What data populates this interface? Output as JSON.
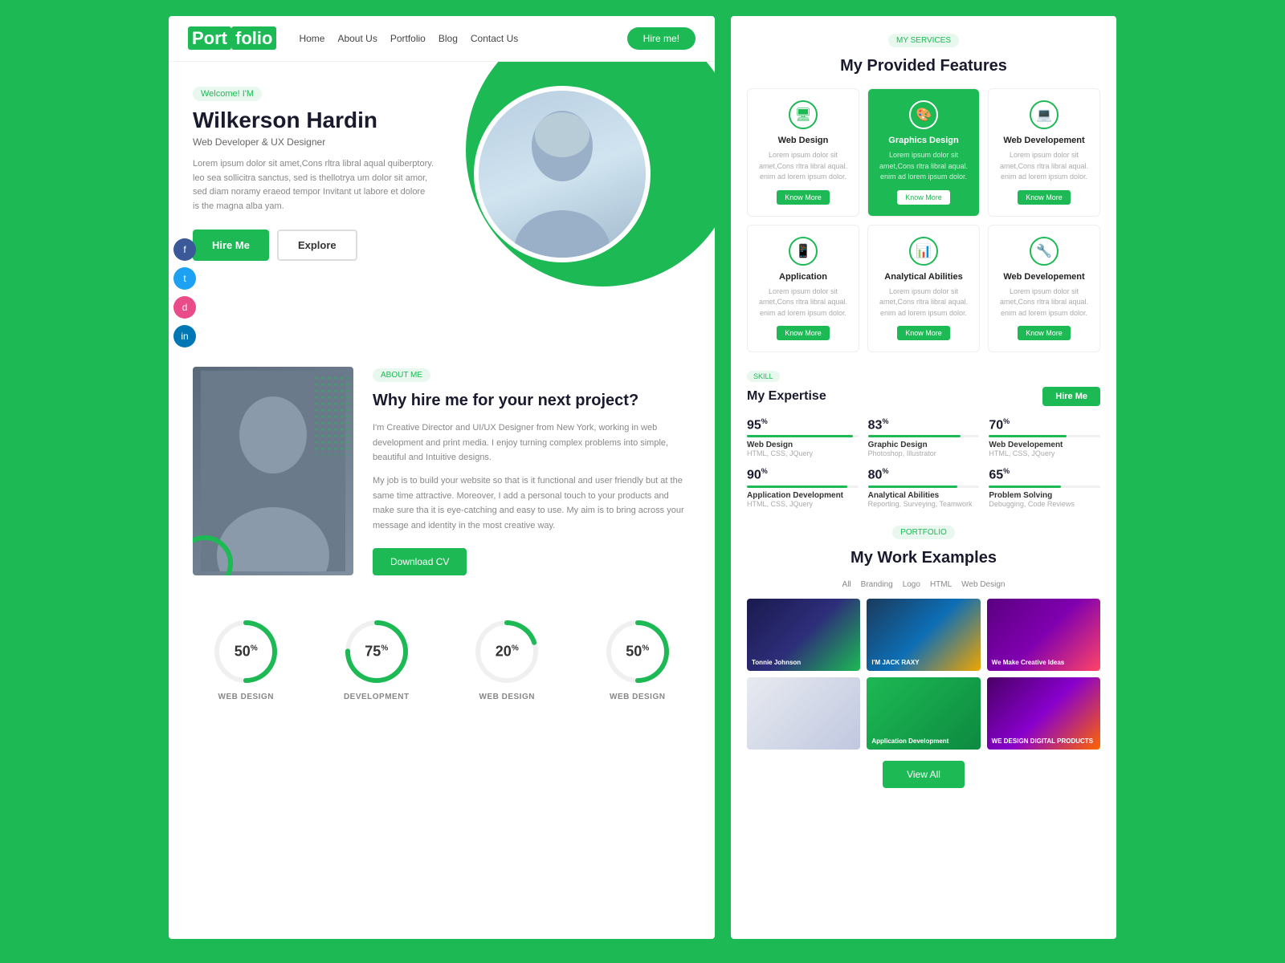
{
  "brand": {
    "name_start": "Port",
    "name_end": "folio"
  },
  "navbar": {
    "links": [
      "Home",
      "About Us",
      "Portfolio",
      "Blog",
      "Contact Us"
    ],
    "hire_btn": "Hire me!"
  },
  "hero": {
    "welcome": "Welcome! I'M",
    "name": "Wilkerson Hardin",
    "title": "Web Developer & UX Designer",
    "description": "Lorem ipsum dolor sit amet,Cons rltra libral aqual quiberptory. leo sea sollicitra sanctus, sed is thellotrya um dolor sit amor, sed diam noramy eraeod tempor Invitant ut labore et dolore is the magna alba yam.",
    "hire_btn": "Hire Me",
    "explore_btn": "Explore"
  },
  "social": {
    "icons": [
      "f",
      "t",
      "d",
      "in"
    ]
  },
  "about": {
    "badge": "ABOUT ME",
    "heading": "Why hire me for your next project?",
    "para1": "I'm Creative Director and UI/UX Designer from New York, working in web development and print media. I enjoy turning complex problems into simple, beautiful and Intuitive designs.",
    "para2": "My job is to build your website so that is it functional and user friendly but at the same time attractive. Moreover, I add a personal touch to your products and make sure tha it is eye-catching and easy to use. My aim is to bring across your message and identity in the most creative way.",
    "download_btn": "Download CV"
  },
  "stats": [
    {
      "pct": "50",
      "label": "WEB DESIGN"
    },
    {
      "pct": "75",
      "label": "DEVELOPMENT"
    },
    {
      "pct": "20",
      "label": "WEB DESIGN"
    },
    {
      "pct": "50",
      "label": "WEB DESIGN"
    }
  ],
  "services": {
    "badge": "MY SERVICES",
    "title": "My Provided Features",
    "items": [
      {
        "icon": "🖥",
        "title": "Web Design",
        "desc": "Lorem ipsum dolor sit amet,Cons rltra libral aqual. enim ad lorem ipsum dolor.",
        "featured": false
      },
      {
        "icon": "🎨",
        "title": "Graphics Design",
        "desc": "Lorem ipsum dolor sit amet,Cons rltra libral aqual. enim ad lorem ipsum dolor.",
        "featured": true
      },
      {
        "icon": "💻",
        "title": "Web Developement",
        "desc": "Lorem ipsum dolor sit amet,Cons rltra libral aqual. enim ad lorem ipsum dolor.",
        "featured": false
      },
      {
        "icon": "📱",
        "title": "Application",
        "desc": "Lorem ipsum dolor sit amet,Cons rltra libral aqual. enim ad lorem ipsum dolor.",
        "featured": false
      },
      {
        "icon": "📊",
        "title": "Analytical Abilities",
        "desc": "Lorem ipsum dolor sit amet,Cons rltra libral aqual. enim ad lorem ipsum dolor.",
        "featured": false
      },
      {
        "icon": "🔧",
        "title": "Web Developement",
        "desc": "Lorem ipsum dolor sit amet,Cons rltra libral aqual. enim ad lorem ipsum dolor.",
        "featured": false
      }
    ],
    "know_more_btn": "Know More"
  },
  "skills": {
    "badge": "SKILL",
    "title": "My Expertise",
    "hire_btn": "Hire Me",
    "items": [
      {
        "pct": "95",
        "name": "Web Design",
        "tech": "HTML, CSS, JQuery"
      },
      {
        "pct": "83",
        "name": "Graphic Design",
        "tech": "Photoshop, Illustrator"
      },
      {
        "pct": "70",
        "name": "Web Developement",
        "tech": "HTML, CSS, JQuery"
      },
      {
        "pct": "90",
        "name": "Application Development",
        "tech": "HTML, CSS, JQuery"
      },
      {
        "pct": "80",
        "name": "Analytical Abilities",
        "tech": "Reporting, Surveying, Teamwork"
      },
      {
        "pct": "65",
        "name": "Problem Solving",
        "tech": "Debugging, Code Reviews"
      }
    ]
  },
  "portfolio": {
    "badge": "PORTFOLIO",
    "title": "My Work Examples",
    "tabs": [
      "All",
      "Branding",
      "Logo",
      "HTML",
      "Web Design"
    ],
    "items": [
      {
        "label": "Tonnie Johnson",
        "bg": "portfolio-bg-1"
      },
      {
        "label": "I'M JACK RAXY",
        "bg": "portfolio-bg-2"
      },
      {
        "label": "We Make Creative Ideas",
        "bg": "portfolio-bg-3"
      },
      {
        "label": "",
        "bg": "portfolio-bg-4"
      },
      {
        "label": "Application Development",
        "bg": "portfolio-bg-5"
      },
      {
        "label": "WE DESIGN DIGITAL PRODUCTS",
        "bg": "portfolio-bg-6"
      }
    ],
    "view_all_btn": "View All"
  }
}
